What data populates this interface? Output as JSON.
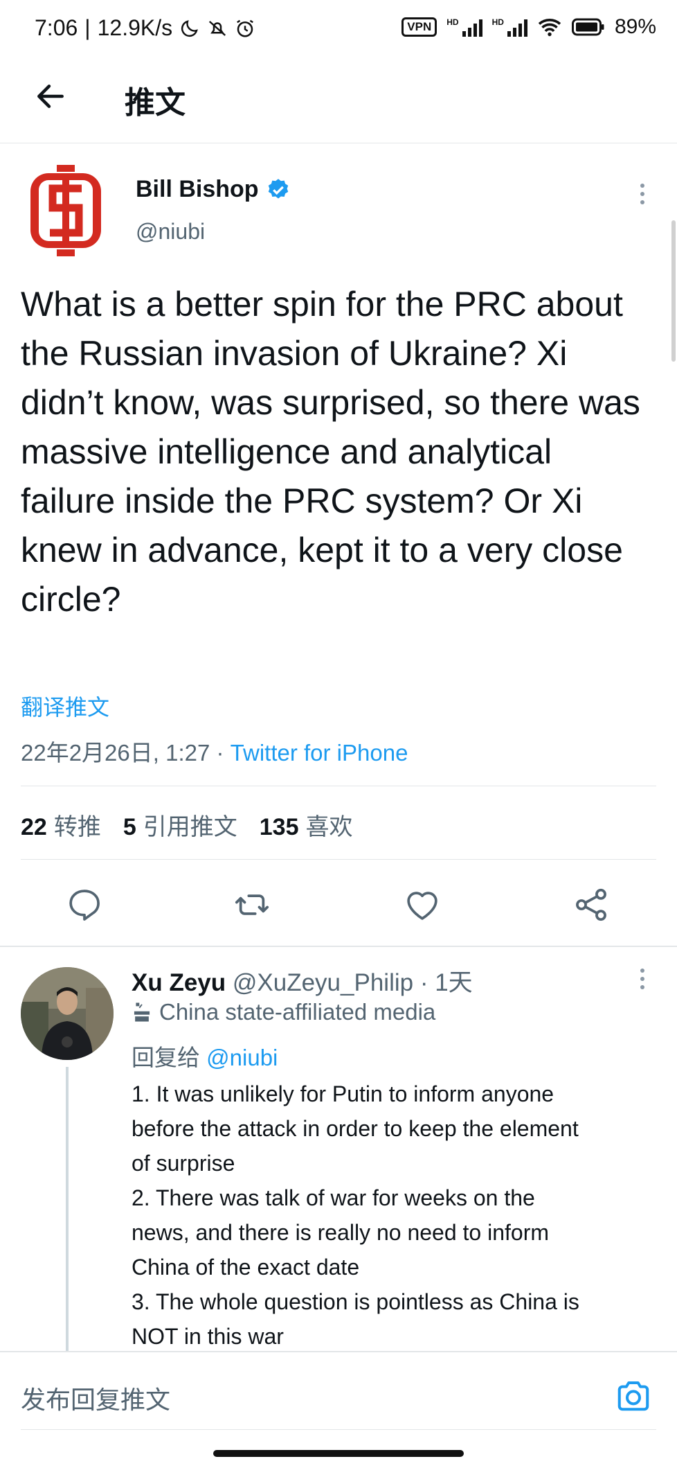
{
  "status_bar": {
    "time": "7:06",
    "speed": "12.9K/s",
    "vpn": "VPN",
    "hd_1": "HD",
    "hd_2": "HD",
    "battery": "89%"
  },
  "header": {
    "title": "推文"
  },
  "tweet": {
    "author_name": "Bill Bishop",
    "author_handle": "@niubi",
    "text": "What is a better spin for the PRC about the Russian invasion of Ukraine? Xi didn’t know, was surprised, so there was massive intelligence and analytical failure inside the PRC system? Or Xi knew in advance, kept it to a very close circle?",
    "translate_label": "翻译推文",
    "timestamp": "22年2月26日, 1:27 · ",
    "source": "Twitter for iPhone",
    "stats": {
      "retweets": "22",
      "retweets_label": "转推",
      "quotes": "5",
      "quotes_label": "引用推文",
      "likes": "135",
      "likes_label": "喜欢"
    }
  },
  "reply": {
    "author_name": "Xu Zeyu",
    "author_handle": "@XuZeyu_Philip",
    "time": " · 1天",
    "label": "China state-affiliated media",
    "reply_prefix": "回复给 ",
    "reply_to": "@niubi",
    "lines": [
      "1. It was unlikely for Putin to inform anyone",
      "before the attack in order to keep the element",
      "of surprise",
      "2. There was talk of war for weeks on the",
      "news, and there is really no need to inform",
      "China of the exact date",
      "3. The whole question is pointless as China is",
      "NOT in this war"
    ]
  },
  "compose": {
    "placeholder": "发布回复推文"
  },
  "colors": {
    "accent": "#1d9bf0",
    "secondary_text": "#536471",
    "logo_red": "#d32a20"
  }
}
